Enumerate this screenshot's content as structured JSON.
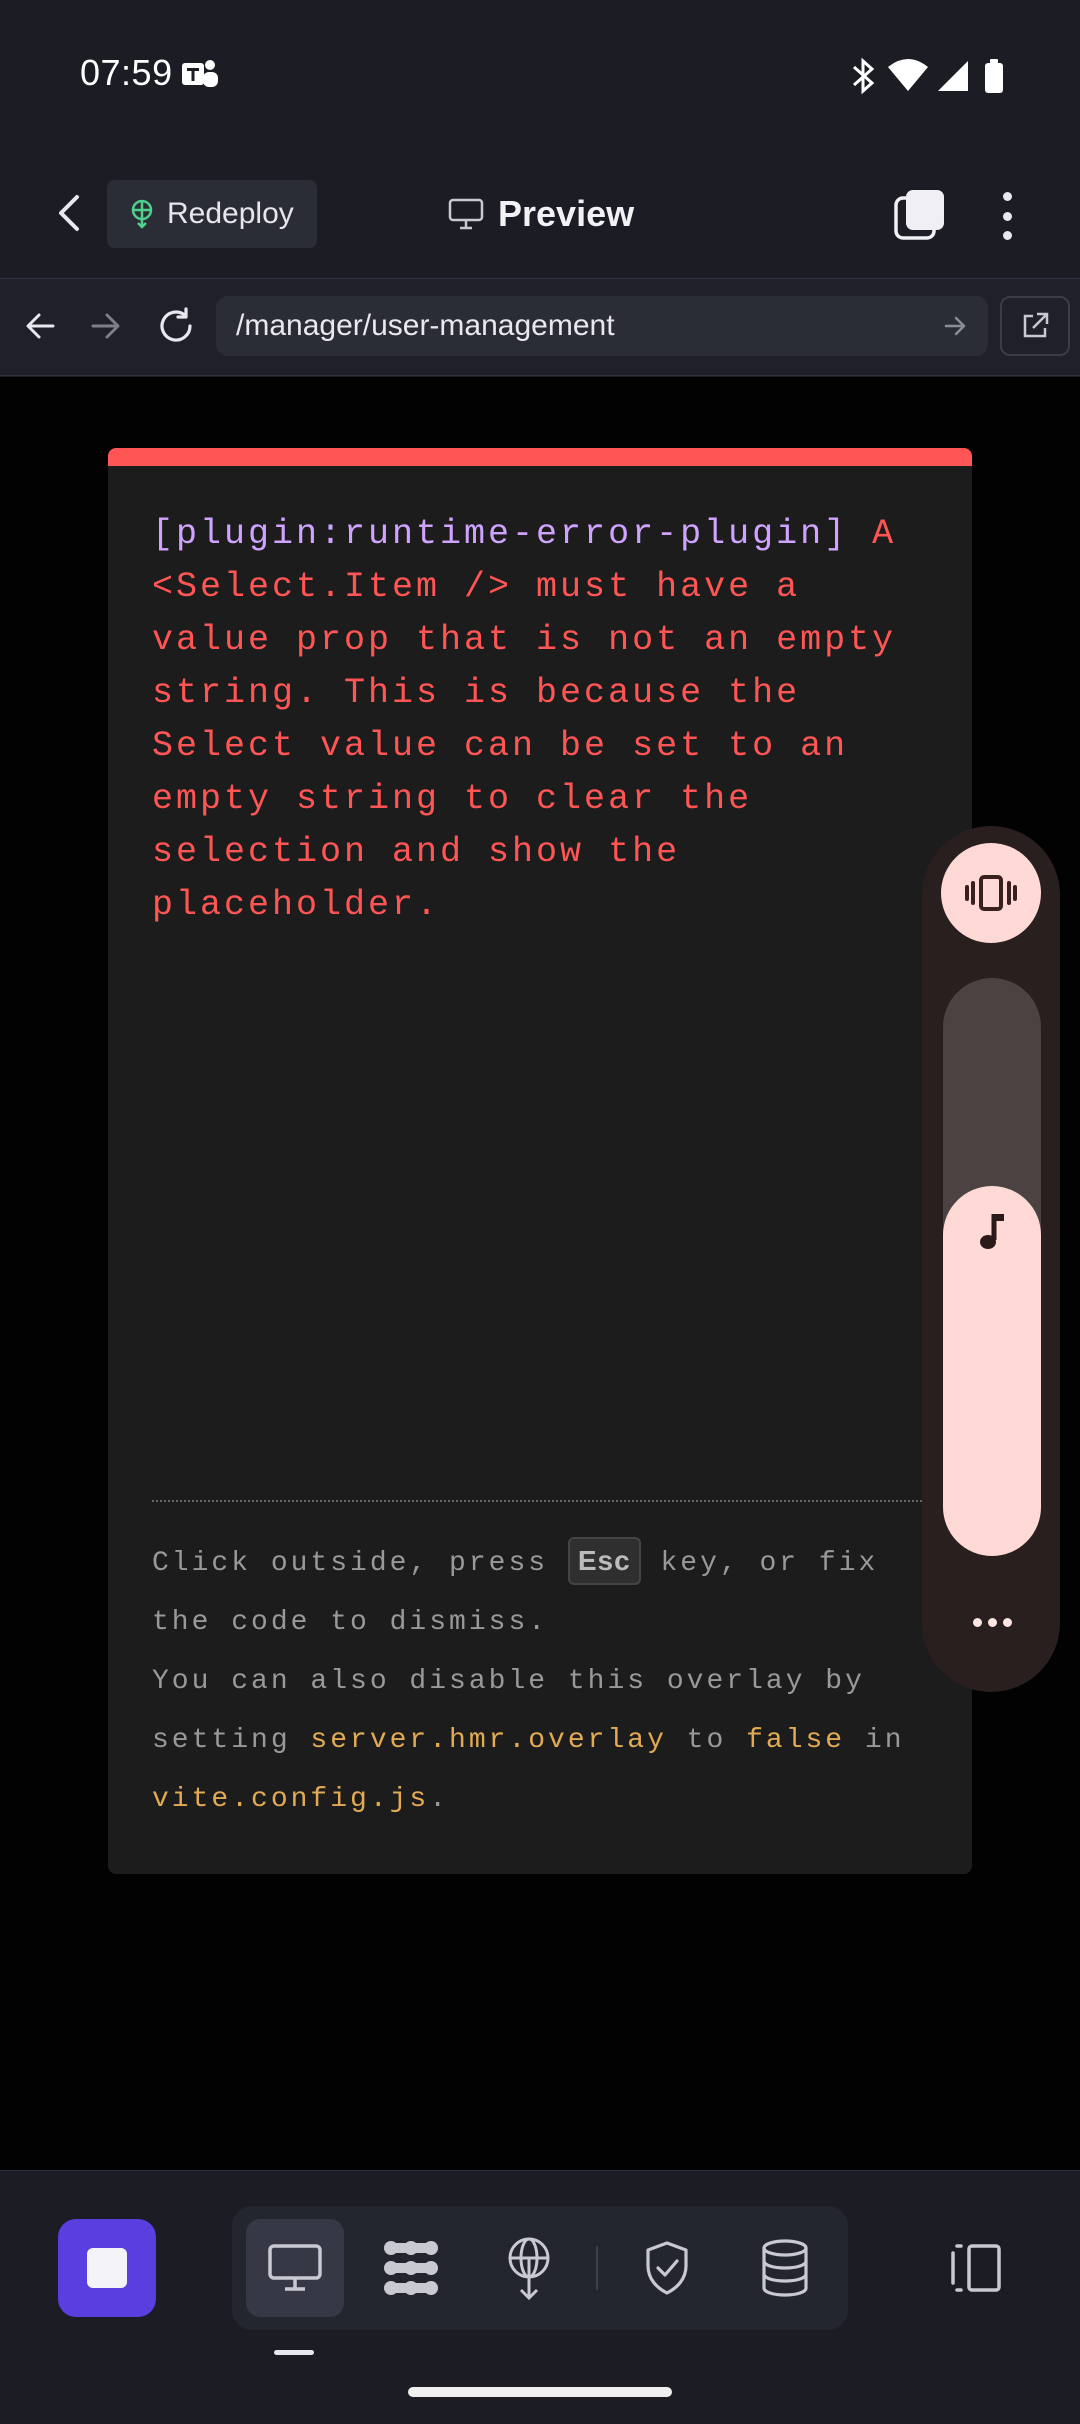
{
  "status_bar": {
    "time": "07:59"
  },
  "header": {
    "redeploy_label": "Redeploy",
    "preview_label": "Preview"
  },
  "url_bar": {
    "path": "/manager/user-management"
  },
  "error_overlay": {
    "plugin": "[plugin:runtime-error-plugin]",
    "message": "A <Select.Item /> must have a value prop that is not an empty string. This is because the Select value can be set to an empty string to clear the selection and show the placeholder.",
    "tip": {
      "part1": "Click outside, press ",
      "key": "Esc",
      "part2": " key, or fix the code to dismiss.",
      "part3": "You can also disable this overlay by setting ",
      "config_key": "server.hmr.overlay",
      "part4": " to ",
      "config_value": "false",
      "part5": " in ",
      "config_file": "vite.config.js",
      "part6": "."
    }
  },
  "volume_panel": {
    "level": 0.64
  },
  "colors": {
    "accent": "#5a3ee0",
    "error": "#ff5555",
    "plugin": "#cfa3ff",
    "highlight": "#e2aa53",
    "volume": "#ffd9d5"
  }
}
